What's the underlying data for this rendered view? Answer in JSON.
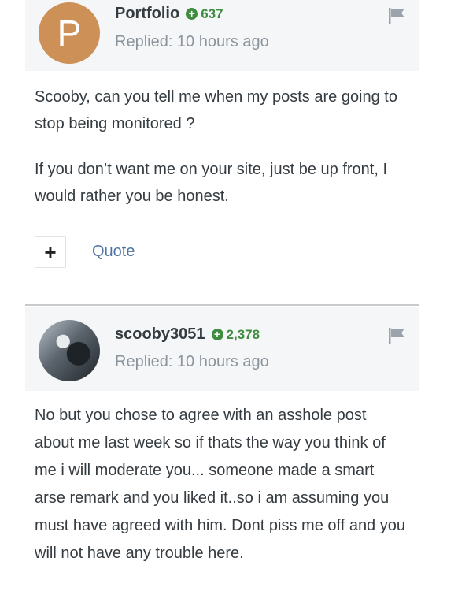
{
  "posts": [
    {
      "author": "Portfolio",
      "avatar_letter": "P",
      "avatar_color": "#cd9158",
      "reputation": "637",
      "replied": "Replied: 10 hours ago",
      "paragraphs": [
        "Scooby, can you tell me when my posts are going to stop being monitored ?",
        "If you don’t want me on your site, just be up front, I would rather you be honest."
      ],
      "actions": {
        "plus": "+",
        "quote": "Quote"
      }
    },
    {
      "author": "scooby3051",
      "reputation": "2,378",
      "replied": "Replied: 10 hours ago",
      "paragraphs": [
        "No but you chose to agree with an asshole post about me last week so if thats the way you think of me i will moderate you... someone made a smart arse remark and you liked it..so i am assuming you must have agreed with him. Dont piss me off and you will not have any trouble here."
      ]
    }
  ],
  "icons": {
    "reputation": "plus-circle-icon",
    "report": "flag-icon"
  },
  "colors": {
    "reputation_green": "#3e8c3e",
    "link_blue": "#4f74a4",
    "header_bg": "#f5f6f7"
  }
}
